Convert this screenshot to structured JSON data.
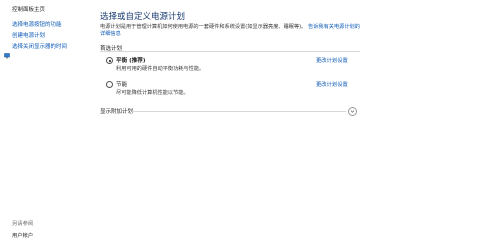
{
  "sidebar": {
    "home": "控制面板主页",
    "items": [
      {
        "label": "选择电源按钮的功能",
        "icon": "none"
      },
      {
        "label": "创建电源计划",
        "icon": "none"
      },
      {
        "label": "选择关闭显示器的时间",
        "icon": "monitor-icon"
      }
    ],
    "see_also": "另请参阅",
    "user_accounts": "用户帐户"
  },
  "main": {
    "title": "选择或自定义电源计划",
    "description_prefix": "电源计划是用于管理计算机如何使用电源的一套硬件和系统设置(如显示器亮度、睡眠等)。",
    "description_link": "告诉我有关电源计划的详细信息",
    "section_label": "首选计划",
    "plans": [
      {
        "name": "平衡 (推荐)",
        "desc": "利用可用的硬件自动平衡功耗与性能。",
        "selected": true,
        "change": "更改计划设置"
      },
      {
        "name": "节能",
        "desc": "尽可能降低计算机性能以节能。",
        "selected": false,
        "change": "更改计划设置"
      }
    ],
    "extra_plans_label": "显示附加计划"
  },
  "colors": {
    "link": "#0a58b5",
    "title": "#1a3c72"
  }
}
